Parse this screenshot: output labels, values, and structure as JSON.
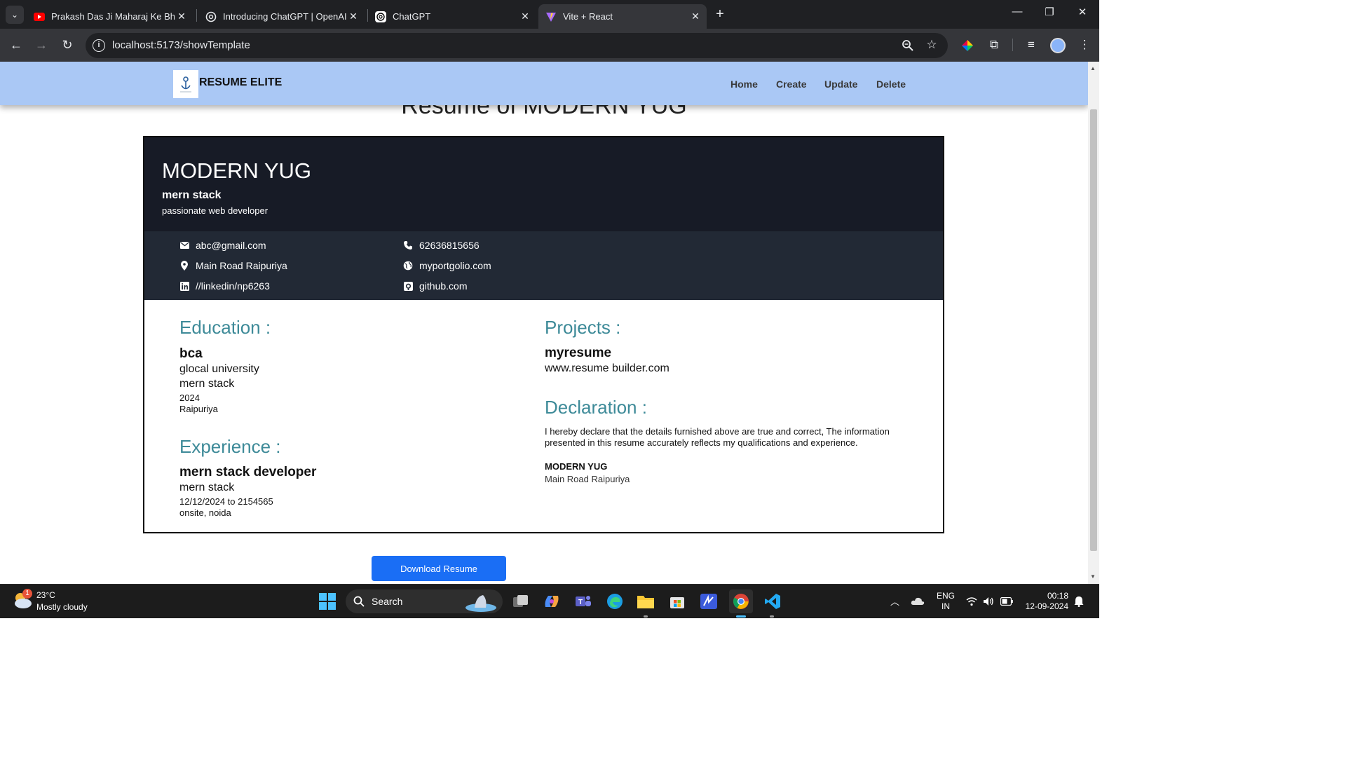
{
  "browser": {
    "tabs": [
      {
        "title": "Prakash Das Ji Maharaj Ke Bhajan",
        "icon": "youtube-icon",
        "active": false
      },
      {
        "title": "Introducing ChatGPT | OpenAI",
        "icon": "openai-icon",
        "active": false
      },
      {
        "title": "ChatGPT",
        "icon": "openai-icon",
        "active": false
      },
      {
        "title": "Vite + React",
        "icon": "vite-icon",
        "active": true
      }
    ],
    "url": "localhost:5173/showTemplate"
  },
  "navbar": {
    "brand": "RESUME ELITE",
    "links": [
      "Home",
      "Create",
      "Update",
      "Delete"
    ]
  },
  "page_title": "Resume of MODERN YUG",
  "resume": {
    "name": "MODERN YUG",
    "role": "mern stack",
    "tagline": "passionate web developer",
    "contact": {
      "email": "abc@gmail.com",
      "phone": "62636815656",
      "address": "Main Road Raipuriya",
      "portfolio": "myportgolio.com",
      "linkedin": "//linkedin/np6263",
      "github": "github.com"
    },
    "education": {
      "heading": "Education :",
      "degree": "bca",
      "institute": "glocal university",
      "field": "mern stack",
      "year": "2024",
      "location": "Raipuriya"
    },
    "experience": {
      "heading": "Experience :",
      "title": "mern stack developer",
      "field": "mern stack",
      "dates": "12/12/2024 to 2154565",
      "location": "onsite, noida"
    },
    "projects": {
      "heading": "Projects :",
      "name": "myresume",
      "link": "www.resume builder.com"
    },
    "declaration": {
      "heading": "Declaration :",
      "text": "I hereby declare that the details furnished above are true and correct, The information presented in this resume accurately reflects my qualifications and experience.",
      "name": "MODERN YUG",
      "place": "Main Road Raipuriya"
    }
  },
  "download_button": "Download Resume",
  "taskbar": {
    "weather_temp": "23°C",
    "weather_desc": "Mostly cloudy",
    "weather_badge": "1",
    "search_label": "Search",
    "lang_top": "ENG",
    "lang_bottom": "IN",
    "time": "00:18",
    "date": "12-09-2024"
  },
  "colors": {
    "navbar": "#aac8f5",
    "resume_header": "#171b26",
    "resume_contact": "#222935",
    "section_title": "#3d8a98",
    "button": "#1a6ef5"
  }
}
